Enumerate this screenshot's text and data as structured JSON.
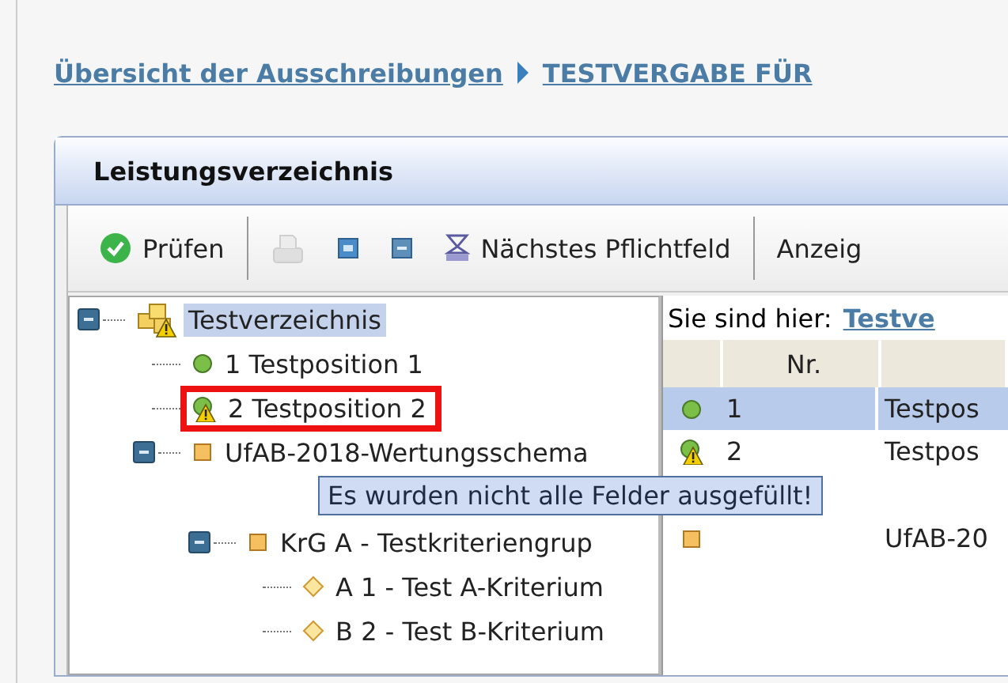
{
  "breadcrumb": [
    {
      "label": "Übersicht der Ausschreibungen"
    },
    {
      "label": "TESTVERGABE FÜR"
    }
  ],
  "panel": {
    "title": "Leistungsverzeichnis"
  },
  "toolbar": [
    {
      "kind": "check",
      "label": "Prüfen",
      "disabled": false
    },
    {
      "kind": "separator"
    },
    {
      "kind": "print",
      "disabled": true
    },
    {
      "kind": "expand",
      "disabled": false
    },
    {
      "kind": "collapse",
      "disabled": false
    },
    {
      "kind": "next",
      "label": "Nächstes Pflichtfeld",
      "disabled": false
    },
    {
      "kind": "separator"
    },
    {
      "kind": "text",
      "label": "Anzeig"
    }
  ],
  "tree": [
    {
      "label": "Testverzeichnis",
      "kind": "root",
      "expanded": true,
      "selected": true,
      "highlighted": false,
      "children": [
        {
          "label": "1 Testposition 1",
          "kind": "ok",
          "selected": false,
          "highlighted": false
        },
        {
          "label": "2 Testposition 2",
          "kind": "warning",
          "selected": false,
          "highlighted": true
        },
        {
          "label": "UfAB-2018-Wertungsschema",
          "kind": "group",
          "expanded": true,
          "selected": false,
          "highlighted": false,
          "children": [
            {
              "label": "KrG A - Testkriteriengrup",
              "kind": "group",
              "expanded": true,
              "selected": false,
              "highlighted": false,
              "children": [
                {
                  "label": "A 1 - Test A-Kriterium",
                  "kind": "criterion",
                  "selected": false,
                  "highlighted": false
                },
                {
                  "label": "B 2 - Test B-Kriterium",
                  "kind": "criterion",
                  "selected": false,
                  "highlighted": false
                }
              ]
            }
          ]
        }
      ]
    }
  ],
  "location": {
    "label": "Sie sind hier:",
    "link": "Testve"
  },
  "table": {
    "columns": [
      "",
      "Nr.",
      ""
    ],
    "rows": [
      {
        "kind": "ok",
        "nr": "1",
        "text": "Testpos",
        "selected": true
      },
      {
        "kind": "warning",
        "nr": "2",
        "text": "Testpos",
        "selected": false
      },
      {
        "kind": "group",
        "nr": "",
        "text": "UfAB-20",
        "selected": false
      }
    ]
  },
  "tooltip": {
    "text": "Es wurden nicht alle Felder ausgefüllt!"
  }
}
